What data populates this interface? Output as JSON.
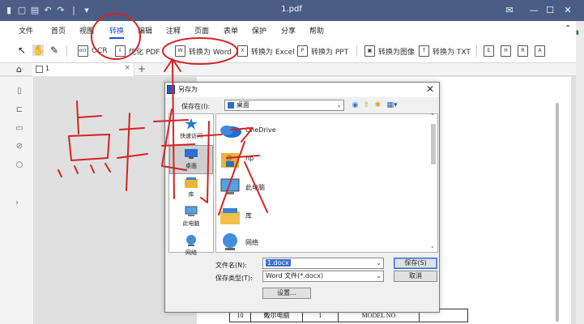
{
  "window": {
    "title": "1.pdf",
    "controls": {
      "mail": "✉",
      "minimize": "—",
      "maximize": "☐",
      "close": "✕"
    }
  },
  "menu": {
    "items": [
      "文件",
      "首页",
      "视图",
      "转换",
      "编辑",
      "注释",
      "页面",
      "表单",
      "保护",
      "分享",
      "帮助"
    ],
    "active": "转换"
  },
  "toolbar": {
    "ocr": "OCR",
    "optimize_pdf": "优化 PDF",
    "to_word": "转换为 Word",
    "to_excel": "转换为 Excel",
    "to_ppt": "转换为 PPT",
    "to_image": "转换为图像",
    "to_txt": "转换为 TXT"
  },
  "tabs": {
    "doc_tab": "1",
    "doc_tab_close": "×",
    "new_tab": "+"
  },
  "document": {
    "row": [
      "10",
      "戴尔电脑",
      "1",
      "MODEL NO",
      ""
    ]
  },
  "dialog": {
    "title": "另存为",
    "save_in_label": "保存在(I):",
    "save_in_value": "桌面",
    "places": [
      "快速访问",
      "桌面",
      "库",
      "此电脑",
      "网络"
    ],
    "files": [
      "OneDrive",
      "hp",
      "此电脑",
      "库",
      "网络"
    ],
    "filename_label": "文件名(N):",
    "filename_value": "1.docx",
    "filetype_label": "保存类型(T):",
    "filetype_value": "Word 文件(*.docx)",
    "save_button": "保存(S)",
    "cancel_button": "取消",
    "settings_button": "设置..."
  },
  "annotation": {
    "text": "点转换",
    "color": "#d42424"
  },
  "colors": {
    "titlebar": "#4a5d85",
    "accent": "#1a4fd0",
    "annotation": "#d42424"
  }
}
